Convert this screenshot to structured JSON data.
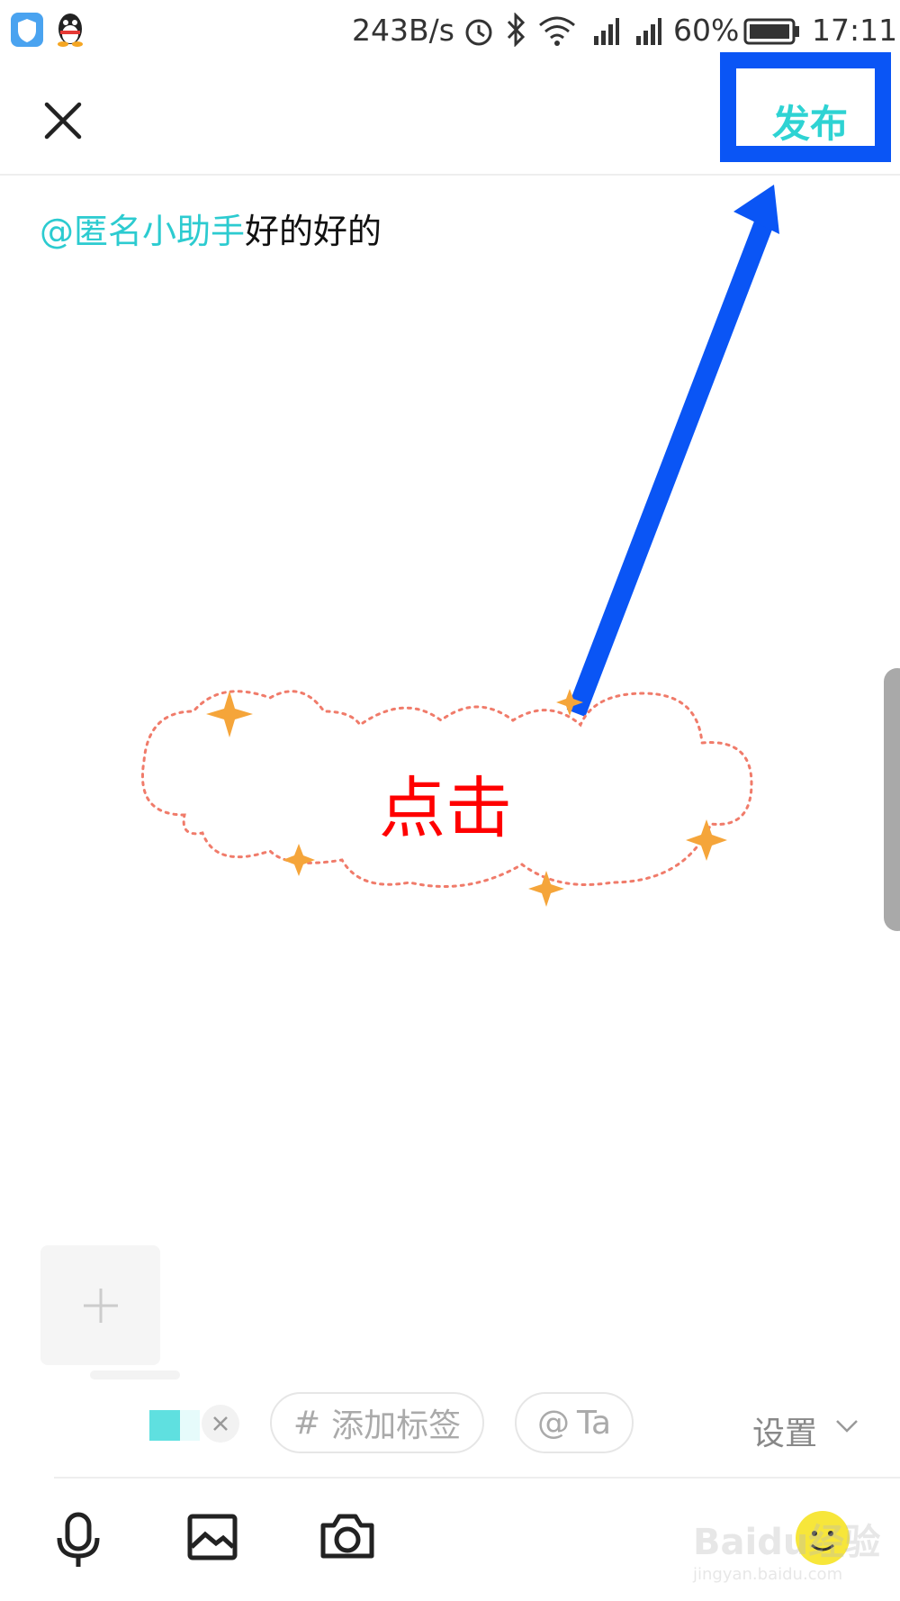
{
  "status_bar": {
    "net_speed": "243B/s",
    "battery_percent": "60%",
    "time": "17:11"
  },
  "header": {
    "close_icon": "close-icon",
    "publish_label": "发布"
  },
  "post": {
    "mention": "@匿名小助手",
    "text": "好的好的"
  },
  "annotation": {
    "label": "点击",
    "arrow_color": "#0a55f5",
    "label_color": "#ff0000"
  },
  "chips": {
    "add_tag": "添加标签",
    "add_tag_icon": "#",
    "at_ta": "Ta",
    "at_icon": "@",
    "settings": "设置"
  },
  "toolbar": {
    "icons": [
      "microphone-icon",
      "image-icon",
      "camera-icon",
      "emoji-icon"
    ]
  },
  "watermark": {
    "brand": "Baidu经验",
    "url": "jingyan.baidu.com"
  },
  "colors": {
    "accent": "#2ccbd0",
    "highlight_box": "#0a55f5"
  }
}
